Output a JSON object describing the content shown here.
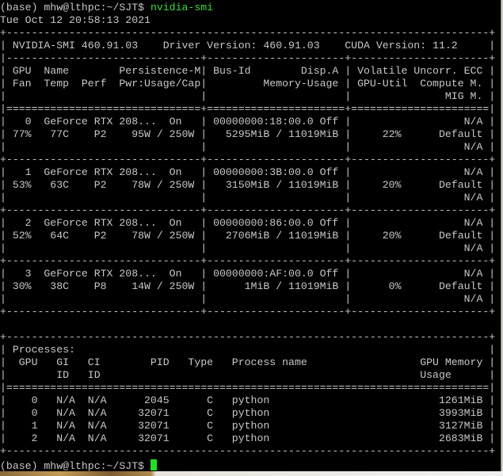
{
  "terminal": {
    "prompt": "(base) mhw@lthpc:~/SJT$",
    "command": " nvidia-smi",
    "timestamp": "Tue Oct 12 20:58:13 2021",
    "lines": [
      "+-----------------------------------------------------------------------------+",
      "| NVIDIA-SMI 460.91.03    Driver Version: 460.91.03    CUDA Version: 11.2     |",
      "|-------------------------------+----------------------+----------------------+",
      "| GPU  Name        Persistence-M| Bus-Id        Disp.A | Volatile Uncorr. ECC |",
      "| Fan  Temp  Perf  Pwr:Usage/Cap|         Memory-Usage | GPU-Util  Compute M. |",
      "|                               |                      |               MIG M. |",
      "|===============================+======================+======================|",
      "|   0  GeForce RTX 208...  On   | 00000000:18:00.0 Off |                  N/A |",
      "| 77%   77C    P2    95W / 250W |   5295MiB / 11019MiB |     22%      Default |",
      "|                               |                      |                  N/A |",
      "+-------------------------------+----------------------+----------------------+",
      "|   1  GeForce RTX 208...  On   | 00000000:3B:00.0 Off |                  N/A |",
      "| 53%   63C    P2    78W / 250W |   3150MiB / 11019MiB |     20%      Default |",
      "|                               |                      |                  N/A |",
      "+-------------------------------+----------------------+----------------------+",
      "|   2  GeForce RTX 208...  On   | 00000000:86:00.0 Off |                  N/A |",
      "| 52%   64C    P2    78W / 250W |   2706MiB / 11019MiB |     20%      Default |",
      "|                               |                      |                  N/A |",
      "+-------------------------------+----------------------+----------------------+",
      "|   3  GeForce RTX 208...  On   | 00000000:AF:00.0 Off |                  N/A |",
      "| 30%   38C    P8    14W / 250W |      1MiB / 11019MiB |      0%      Default |",
      "|                               |                      |                  N/A |",
      "+-------------------------------+----------------------+----------------------+",
      "",
      "+-----------------------------------------------------------------------------+",
      "| Processes:                                                                  |",
      "|  GPU   GI   CI        PID   Type   Process name                  GPU Memory |",
      "|        ID   ID                                                   Usage      |",
      "|=============================================================================|",
      "|    0   N/A  N/A      2045      C   python                           1261MiB |",
      "|    0   N/A  N/A     32071      C   python                           3993MiB |",
      "|    1   N/A  N/A     32071      C   python                           3127MiB |",
      "|    2   N/A  N/A     32071      C   python                           2683MiB |",
      "+-----------------------------------------------------------------------------+"
    ],
    "final_prompt": "(base) mhw@lthpc:~/SJT$ "
  },
  "colors": {
    "background": "#000000",
    "text": "#c8c8c8",
    "command": "#3ddc3d",
    "cursor": "#22dd22"
  }
}
